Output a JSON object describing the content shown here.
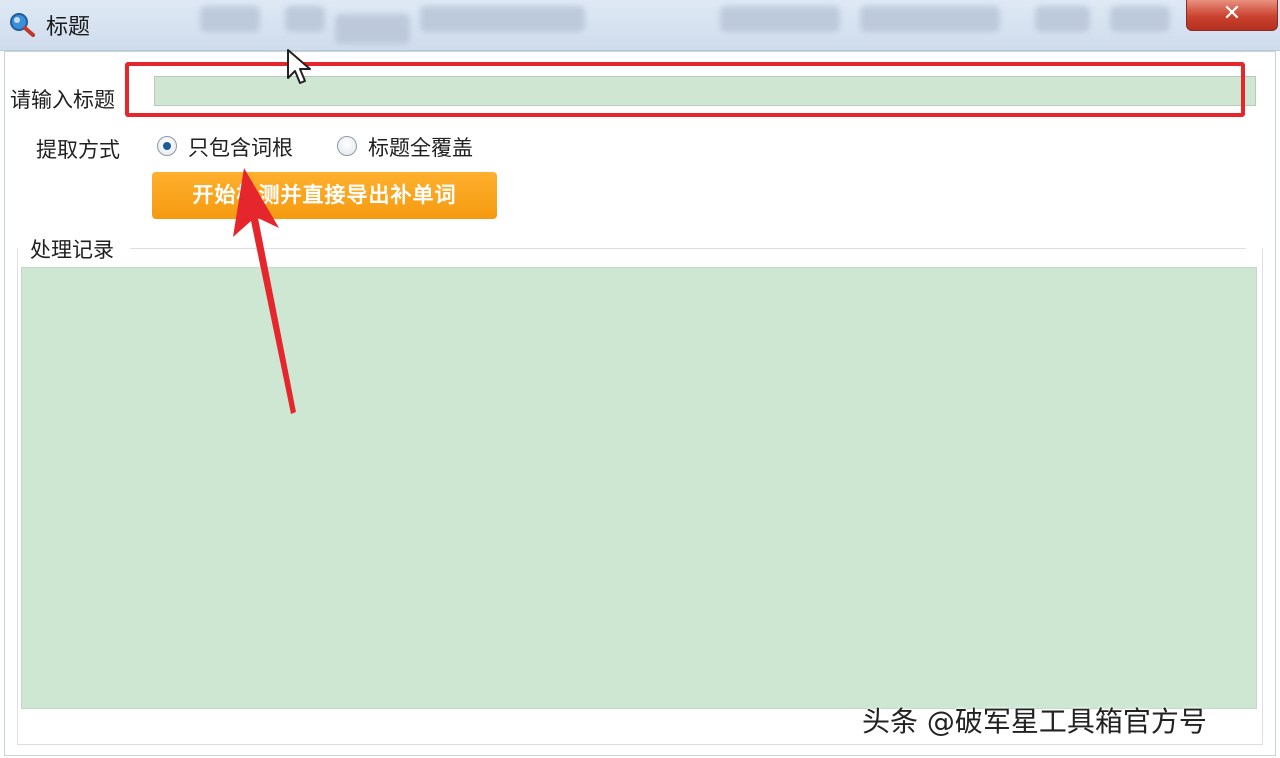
{
  "window": {
    "title": "标题",
    "close_glyph": "✕"
  },
  "form": {
    "title_label": "请输入标题",
    "title_value": "",
    "extract_label": "提取方式",
    "options": [
      {
        "label": "只包含词根",
        "checked": true
      },
      {
        "label": "标题全覆盖",
        "checked": false
      }
    ],
    "action_button": "开始检测并直接导出补单词"
  },
  "log": {
    "group_label": "处理记录",
    "content": ""
  },
  "watermark": "头条 @破军星工具箱官方号",
  "colors": {
    "annotation_red": "#e5262d",
    "button_orange": "#f59a10",
    "field_green": "#cfe6d3"
  },
  "icons": {
    "app": "search-magnifier-icon",
    "radio_checked": "radio-checked-icon",
    "radio_unchecked": "radio-unchecked-icon"
  }
}
